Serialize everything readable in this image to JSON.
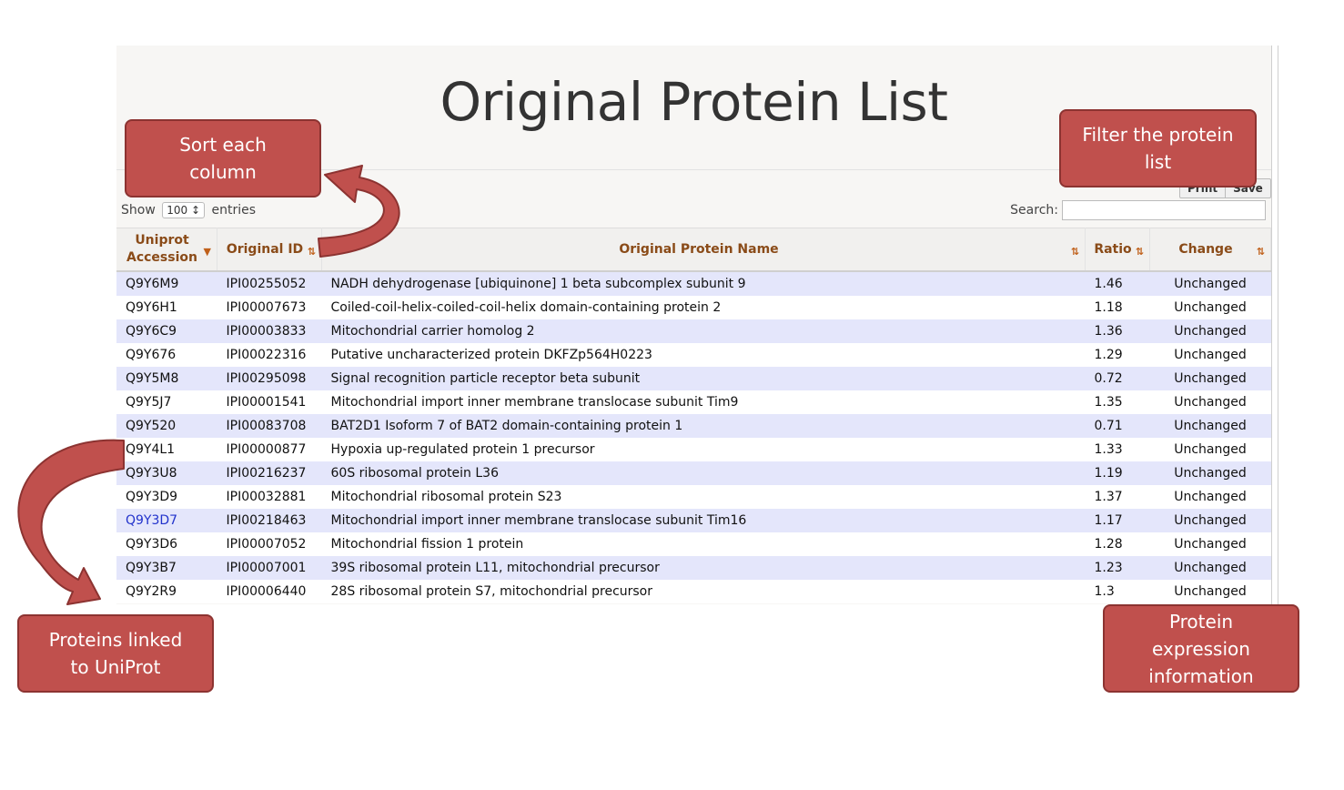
{
  "page": {
    "title": "Original Protein List"
  },
  "controls": {
    "show_label": "Show",
    "entries_value": "100",
    "entries_label": "entries",
    "search_label": "Search:",
    "search_value": "",
    "print_label": "Print",
    "save_label": "Save"
  },
  "table": {
    "columns": [
      "Uniprot Accession",
      "Original ID",
      "Original Protein Name",
      "Ratio",
      "Change"
    ],
    "rows": [
      {
        "acc": "Q9Y6M9",
        "id": "IPI00255052",
        "name": "NADH dehydrogenase [ubiquinone] 1 beta subcomplex subunit 9",
        "ratio": "1.46",
        "change": "Unchanged"
      },
      {
        "acc": "Q9Y6H1",
        "id": "IPI00007673",
        "name": "Coiled-coil-helix-coiled-coil-helix domain-containing protein 2",
        "ratio": "1.18",
        "change": "Unchanged"
      },
      {
        "acc": "Q9Y6C9",
        "id": "IPI00003833",
        "name": "Mitochondrial carrier homolog 2",
        "ratio": "1.36",
        "change": "Unchanged"
      },
      {
        "acc": "Q9Y676",
        "id": "IPI00022316",
        "name": "Putative uncharacterized protein DKFZp564H0223",
        "ratio": "1.29",
        "change": "Unchanged"
      },
      {
        "acc": "Q9Y5M8",
        "id": "IPI00295098",
        "name": "Signal recognition particle receptor beta subunit",
        "ratio": "0.72",
        "change": "Unchanged"
      },
      {
        "acc": "Q9Y5J7",
        "id": "IPI00001541",
        "name": "Mitochondrial import inner membrane translocase subunit Tim9",
        "ratio": "1.35",
        "change": "Unchanged"
      },
      {
        "acc": "Q9Y520",
        "id": "IPI00083708",
        "name": "BAT2D1 Isoform 7 of BAT2 domain-containing protein 1",
        "ratio": "0.71",
        "change": "Unchanged"
      },
      {
        "acc": "Q9Y4L1",
        "id": "IPI00000877",
        "name": "Hypoxia up-regulated protein 1 precursor",
        "ratio": "1.33",
        "change": "Unchanged"
      },
      {
        "acc": "Q9Y3U8",
        "id": "IPI00216237",
        "name": "60S ribosomal protein L36",
        "ratio": "1.19",
        "change": "Unchanged"
      },
      {
        "acc": "Q9Y3D9",
        "id": "IPI00032881",
        "name": "Mitochondrial ribosomal protein S23",
        "ratio": "1.37",
        "change": "Unchanged"
      },
      {
        "acc": "Q9Y3D7",
        "id": "IPI00218463",
        "name": "Mitochondrial import inner membrane translocase subunit Tim16",
        "ratio": "1.17",
        "change": "Unchanged",
        "linked": true
      },
      {
        "acc": "Q9Y3D6",
        "id": "IPI00007052",
        "name": "Mitochondrial fission 1 protein",
        "ratio": "1.28",
        "change": "Unchanged"
      },
      {
        "acc": "Q9Y3B7",
        "id": "IPI00007001",
        "name": "39S ribosomal protein L11, mitochondrial precursor",
        "ratio": "1.23",
        "change": "Unchanged"
      },
      {
        "acc": "Q9Y2R9",
        "id": "IPI00006440",
        "name": "28S ribosomal protein S7, mitochondrial precursor",
        "ratio": "1.3",
        "change": "Unchanged"
      }
    ]
  },
  "callouts": {
    "sort": "Sort each column",
    "filter": "Filter the protein list",
    "uniprot": "Proteins linked to UniProt",
    "expression": "Protein expression information"
  },
  "colors": {
    "callout_fill": "#c0504d",
    "callout_border": "#8c3331",
    "header_text": "#8a4b18",
    "row_stripe": "#e4e6fb",
    "link": "#2233cc"
  }
}
